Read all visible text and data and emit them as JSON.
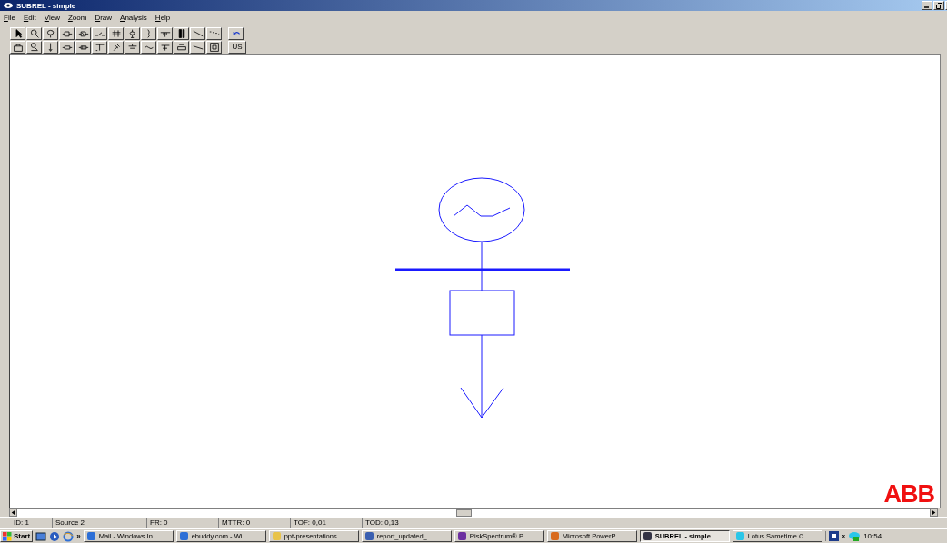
{
  "window": {
    "title": "SUBREL - simple"
  },
  "menu": [
    "File",
    "Edit",
    "View",
    "Zoom",
    "Draw",
    "Analysis",
    "Help"
  ],
  "toolbar": {
    "text_button": "US"
  },
  "logo": "ABB",
  "status_bar": [
    "ID:  1",
    "Source  2",
    "FR: 0",
    "MTTR: 0",
    "TOF: 0,01",
    "TOD: 0,13"
  ],
  "taskbar": {
    "start": "Start",
    "more": "»",
    "tasks": [
      {
        "label": "Mail - Windows In...",
        "selected": false
      },
      {
        "label": "ebuddy.com - Wi...",
        "selected": false
      },
      {
        "label": "ppt-presentations",
        "selected": false
      },
      {
        "label": "report_updated_...",
        "selected": false
      },
      {
        "label": "RiskSpectrum® P...",
        "selected": false
      },
      {
        "label": "Microsoft PowerP...",
        "selected": false
      },
      {
        "label": "SUBREL - simple",
        "selected": true
      },
      {
        "label": "Lotus Sametime C...",
        "selected": false
      }
    ],
    "tray_arrow": "«",
    "clock": "10:54"
  }
}
